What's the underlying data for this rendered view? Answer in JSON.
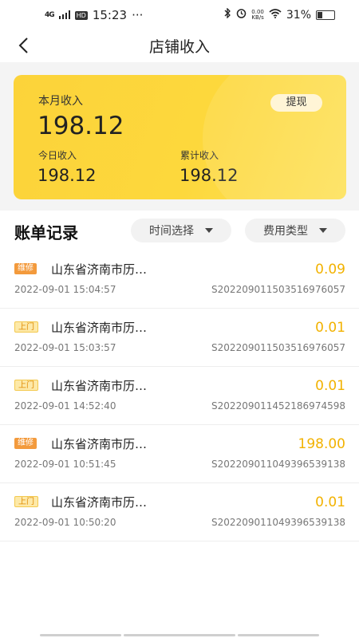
{
  "status_bar": {
    "signal": "4G",
    "hd": "HD",
    "time": "15:23",
    "dots": "···",
    "net_speed_top": "0.00",
    "net_speed_bottom": "KB/s",
    "battery": "31%",
    "battery_level": 0.31
  },
  "nav": {
    "title": "店铺收入"
  },
  "summary": {
    "month_label": "本月收入",
    "month_value": "198.12",
    "withdraw_label": "提现",
    "today_label": "今日收入",
    "today_value": "198.12",
    "total_label": "累计收入",
    "total_value": "198.12"
  },
  "bills": {
    "title": "账单记录",
    "filter_time": "时间选择",
    "filter_type": "费用类型",
    "records": [
      {
        "tag": "维修",
        "tag_type": "repair",
        "address": "山东省济南市历…",
        "amount": "0.09",
        "time": "2022-09-01 15:04:57",
        "order": "S2022090115035169760​57"
      },
      {
        "tag": "上门",
        "tag_type": "visit",
        "address": "山东省济南市历…",
        "amount": "0.01",
        "time": "2022-09-01 15:03:57",
        "order": "S202209011503516976057"
      },
      {
        "tag": "上门",
        "tag_type": "visit",
        "address": "山东省济南市历…",
        "amount": "0.01",
        "time": "2022-09-01 14:52:40",
        "order": "S202209011452186974598"
      },
      {
        "tag": "维修",
        "tag_type": "repair",
        "address": "山东省济南市历…",
        "amount": "198.00",
        "time": "2022-09-01 10:51:45",
        "order": "S202209011049396539138"
      },
      {
        "tag": "上门",
        "tag_type": "visit",
        "address": "山东省济南市历…",
        "amount": "0.01",
        "time": "2022-09-01 10:50:20",
        "order": "S202209011049396539138"
      }
    ]
  },
  "colors": {
    "accent_yellow": "#fcd33a",
    "amount": "#f2b200",
    "tag_repair": "#f39a3c",
    "tag_visit": "#fde9a8"
  }
}
